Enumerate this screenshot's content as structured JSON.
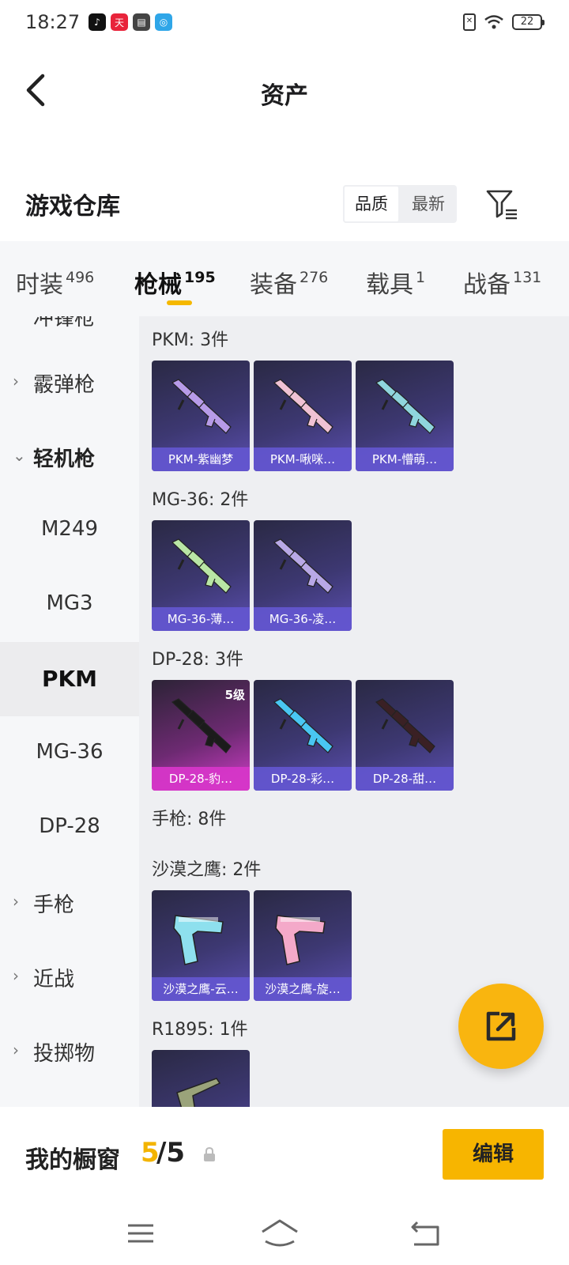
{
  "status_bar": {
    "time": "18:27",
    "apps": [
      {
        "name": "tiktok-app-icon",
        "color": "#111111",
        "glyph": "♪"
      },
      {
        "name": "tianmao-app-icon",
        "color": "#e8243b",
        "glyph": "天"
      },
      {
        "name": "wallet-app-icon",
        "color": "#444444",
        "glyph": "▤"
      },
      {
        "name": "browser-app-icon",
        "color": "#2fa6e8",
        "glyph": "◎"
      }
    ],
    "battery": "22"
  },
  "header": {
    "title": "资产"
  },
  "warehouse": {
    "title": "游戏仓库",
    "sort_options": [
      "品质",
      "最新"
    ]
  },
  "tabs": [
    {
      "label": "时装",
      "count": "496"
    },
    {
      "label": "枪械",
      "count": "195"
    },
    {
      "label": "装备",
      "count": "276"
    },
    {
      "label": "载具",
      "count": "1"
    },
    {
      "label": "战备",
      "count": "131"
    }
  ],
  "sidebar": {
    "partial_label": "冲锋枪",
    "items": [
      {
        "label": "霰弹枪",
        "arrow": "›"
      },
      {
        "label": "轻机枪",
        "arrow": "⌄"
      },
      {
        "label": "M249"
      },
      {
        "label": "MG3"
      },
      {
        "label": "PKM"
      },
      {
        "label": "MG-36"
      },
      {
        "label": "DP-28"
      },
      {
        "label": "手枪",
        "arrow": "›"
      },
      {
        "label": "近战",
        "arrow": "›"
      },
      {
        "label": "投掷物",
        "arrow": "›"
      }
    ]
  },
  "groups": [
    {
      "title": "PKM: 3件",
      "items": [
        {
          "name": "PKM-紫幽梦",
          "color": "#b79be8"
        },
        {
          "name": "PKM-啾咪…",
          "color": "#f0c2d4"
        },
        {
          "name": "PKM-懵萌…",
          "color": "#8fd5dd"
        }
      ]
    },
    {
      "title": "MG-36: 2件",
      "items": [
        {
          "name": "MG-36-薄…",
          "color": "#b9e6a5"
        },
        {
          "name": "MG-36-凌…",
          "color": "#b8a8e6"
        }
      ]
    },
    {
      "title": "DP-28: 3件",
      "items": [
        {
          "name": "DP-28-豹…",
          "color": "#1b1b1b",
          "grade": "5级"
        },
        {
          "name": "DP-28-彩…",
          "color": "#49c6f2"
        },
        {
          "name": "DP-28-甜…",
          "color": "#3a2024"
        }
      ]
    },
    {
      "title": "手枪: 8件",
      "items": []
    },
    {
      "title": "沙漠之鹰: 2件",
      "items": [
        {
          "name": "沙漠之鹰-云…",
          "color": "#8ee0ee"
        },
        {
          "name": "沙漠之鹰-旋…",
          "color": "#f4a9c9"
        }
      ]
    },
    {
      "title": "R1895: 1件",
      "items": [
        {
          "name": "",
          "color": "#9aa37a"
        }
      ]
    }
  ],
  "bottom": {
    "showcase_label": "我的橱窗",
    "current": "5",
    "total": "/5",
    "edit_label": "编辑"
  },
  "colors": {
    "accent": "#f5b800",
    "card_purple": "#5b4fb0",
    "card_pink": "#d03ec8"
  }
}
